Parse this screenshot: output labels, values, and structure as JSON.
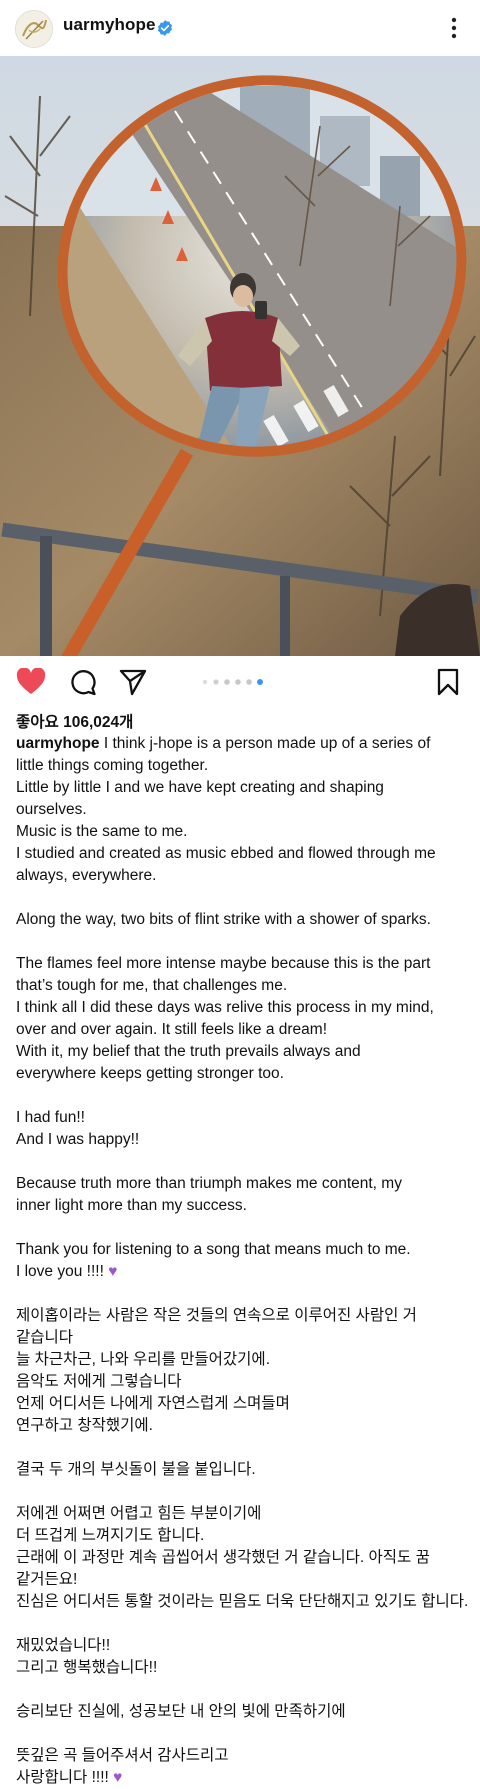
{
  "header": {
    "username": "uarmyhope",
    "avatar_icon": "avatar-signature-icon",
    "verified_icon": "verified-badge-icon",
    "more_icon": "more-vertical-icon"
  },
  "photo": {
    "description_icon": "post-photo"
  },
  "actions": {
    "like_icon": "heart-filled-icon",
    "comment_icon": "comment-icon",
    "share_icon": "send-icon",
    "save_icon": "bookmark-icon",
    "carousel_count": 6,
    "carousel_active": 6,
    "like_color": "#ed4956",
    "active_dot_color": "#3897f0"
  },
  "likes_text": "좋아요 106,024개",
  "caption": {
    "username": "uarmyhope",
    "first_line_rest": " I think j-hope is a person made up of a series of",
    "lines": [
      "little things coming together.",
      "Little by little I and we have kept creating and shaping",
      "ourselves.",
      "Music is the same to me.",
      "I studied and created as music ebbed and flowed through me",
      "always, everywhere.",
      "",
      "Along the way, two bits of flint strike with a shower of sparks.",
      "",
      "The flames feel more intense maybe because this is the part",
      "that’s tough for me, that challenges me.",
      "I think all I did these days was relive this process in my mind,",
      "over and over again. It still feels like a dream!",
      "With it, my belief that the truth prevails always and",
      "everywhere keeps getting stronger too.",
      "",
      "I had fun!!",
      "And I was happy!!",
      "",
      "Because truth more than triumph makes me content, my",
      "inner light more than my success.",
      "",
      "Thank you for listening to a song that means much to me.",
      "I love you  !!!! 💜",
      "",
      "제이홉이라는 사람은 작은 것들의 연속으로 이루어진 사람인 거",
      "같습니다",
      "늘 차근차근, 나와 우리를 만들어갔기에.",
      "음악도 저에게 그렇습니다",
      "언제 어디서든 나에게 자연스럽게 스며들며",
      "연구하고 창작했기에.",
      "",
      "결국 두 개의 부싯돌이 불을 붙입니다.",
      "",
      "저에겐 어쩌면 어렵고 힘든 부분이기에",
      "더 뜨겁게 느껴지기도 합니다.",
      "근래에 이 과정만 계속 곱씹어서 생각했던 거 같습니다. 아직도 꿈",
      "같거든요!",
      "진심은 어디서든 통할 것이라는 믿음도 더욱 단단해지고 있기도 합니다.",
      "",
      "재밌었습니다!!",
      "그리고 행복했습니다!!",
      "",
      "승리보단 진실에, 성공보단 내 안의 빛에 만족하기에",
      "",
      "뜻깊은 곡 들어주셔서 감사드리고",
      "사랑합니다 !!!! 💜"
    ]
  }
}
